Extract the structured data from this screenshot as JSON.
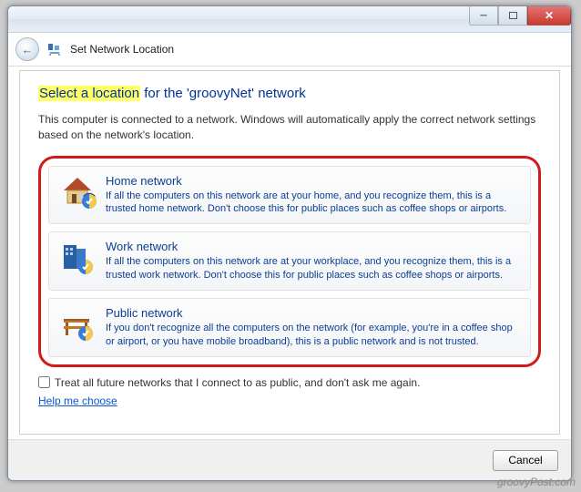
{
  "header": {
    "title": "Set Network Location"
  },
  "instruction": {
    "highlighted": "Select a location",
    "rest": " for the 'groovyNet' network"
  },
  "description": "This computer is connected to a network. Windows will automatically apply the correct network settings based on the network's location.",
  "options": [
    {
      "title": "Home network",
      "desc": "If all the computers on this network are at your home, and you recognize them, this is a trusted home network.  Don't choose this for public places such as coffee shops or airports."
    },
    {
      "title": "Work network",
      "desc": "If all the computers on this network are at your workplace, and you recognize them, this is a trusted work network.  Don't choose this for public places such as coffee shops or airports."
    },
    {
      "title": "Public network",
      "desc": "If you don't recognize all the computers on the network (for example, you're in a coffee shop or airport, or you have mobile broadband), this is a public network and is not trusted."
    }
  ],
  "checkbox_label": "Treat all future networks that I connect to as public, and don't ask me again.",
  "help_link": "Help me choose",
  "buttons": {
    "cancel": "Cancel"
  },
  "watermark": "groovyPost.com"
}
